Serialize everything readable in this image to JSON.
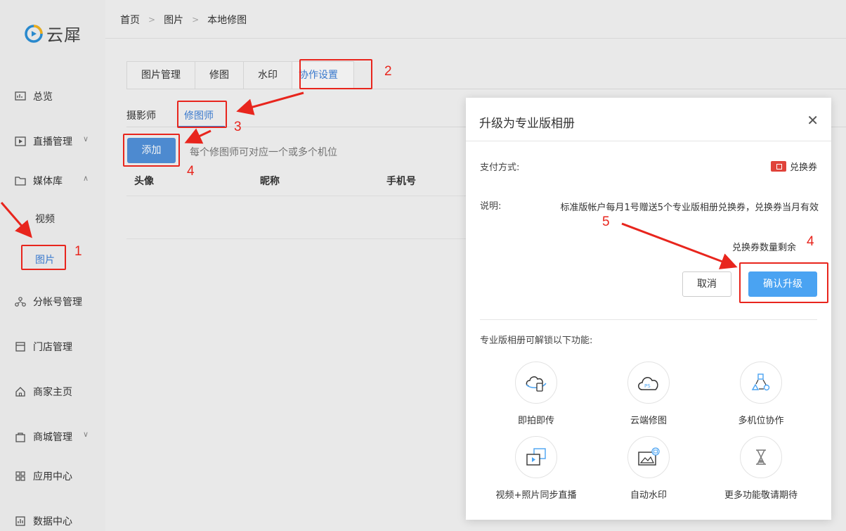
{
  "brand": {
    "name": "云犀"
  },
  "sidebar": {
    "items": [
      {
        "label": "总览",
        "icon": "overview-icon"
      },
      {
        "label": "直播管理",
        "icon": "live-icon",
        "chevron": "down"
      },
      {
        "label": "媒体库",
        "icon": "folder-icon",
        "chevron": "up"
      },
      {
        "label": "分帐号管理",
        "icon": "org-icon"
      },
      {
        "label": "门店管理",
        "icon": "store-icon"
      },
      {
        "label": "商家主页",
        "icon": "home-icon"
      },
      {
        "label": "商城管理",
        "icon": "bag-icon",
        "chevron": "down"
      },
      {
        "label": "应用中心",
        "icon": "apps-icon"
      },
      {
        "label": "数据中心",
        "icon": "data-icon"
      }
    ],
    "sub_items": [
      {
        "label": "视频"
      },
      {
        "label": "图片",
        "active": true
      }
    ]
  },
  "breadcrumb": [
    "首页",
    "图片",
    "本地修图"
  ],
  "tabs": [
    {
      "label": "图片管理"
    },
    {
      "label": "修图"
    },
    {
      "label": "水印"
    },
    {
      "label": "协作设置",
      "active": true
    }
  ],
  "subtabs": [
    {
      "label": "摄影师"
    },
    {
      "label": "修图师",
      "active": true
    }
  ],
  "add_button": "添加",
  "hint": "每个修图师可对应一个或多个机位",
  "table_headers": [
    "头像",
    "昵称",
    "手机号"
  ],
  "modal": {
    "title": "升级为专业版相册",
    "payment_label": "支付方式:",
    "payment_value": "兑换券",
    "desc_label": "说明:",
    "desc_value": "标准版帐户每月1号赠送5个专业版相册兑换券，兑换券当月有效",
    "remain_label": "兑换券数量剩余",
    "cancel": "取消",
    "confirm": "确认升级",
    "unlock_title": "专业版相册可解锁以下功能:",
    "features": [
      {
        "label": "即拍即传",
        "icon": "cloud-upload-icon"
      },
      {
        "label": "云端修图",
        "icon": "cloud-ps-icon"
      },
      {
        "label": "多机位协作",
        "icon": "multi-camera-icon"
      },
      {
        "label": "视频+照片同步直播",
        "icon": "video-photo-icon"
      },
      {
        "label": "自动水印",
        "icon": "watermark-icon"
      },
      {
        "label": "更多功能敬请期待",
        "icon": "hourglass-icon"
      }
    ]
  },
  "annotations": [
    "1",
    "2",
    "3",
    "4",
    "4",
    "5"
  ],
  "colors": {
    "accent": "#3d7fd6",
    "button": "#5190d9",
    "confirm": "#4aa3f2",
    "annotation": "#e8251d"
  }
}
